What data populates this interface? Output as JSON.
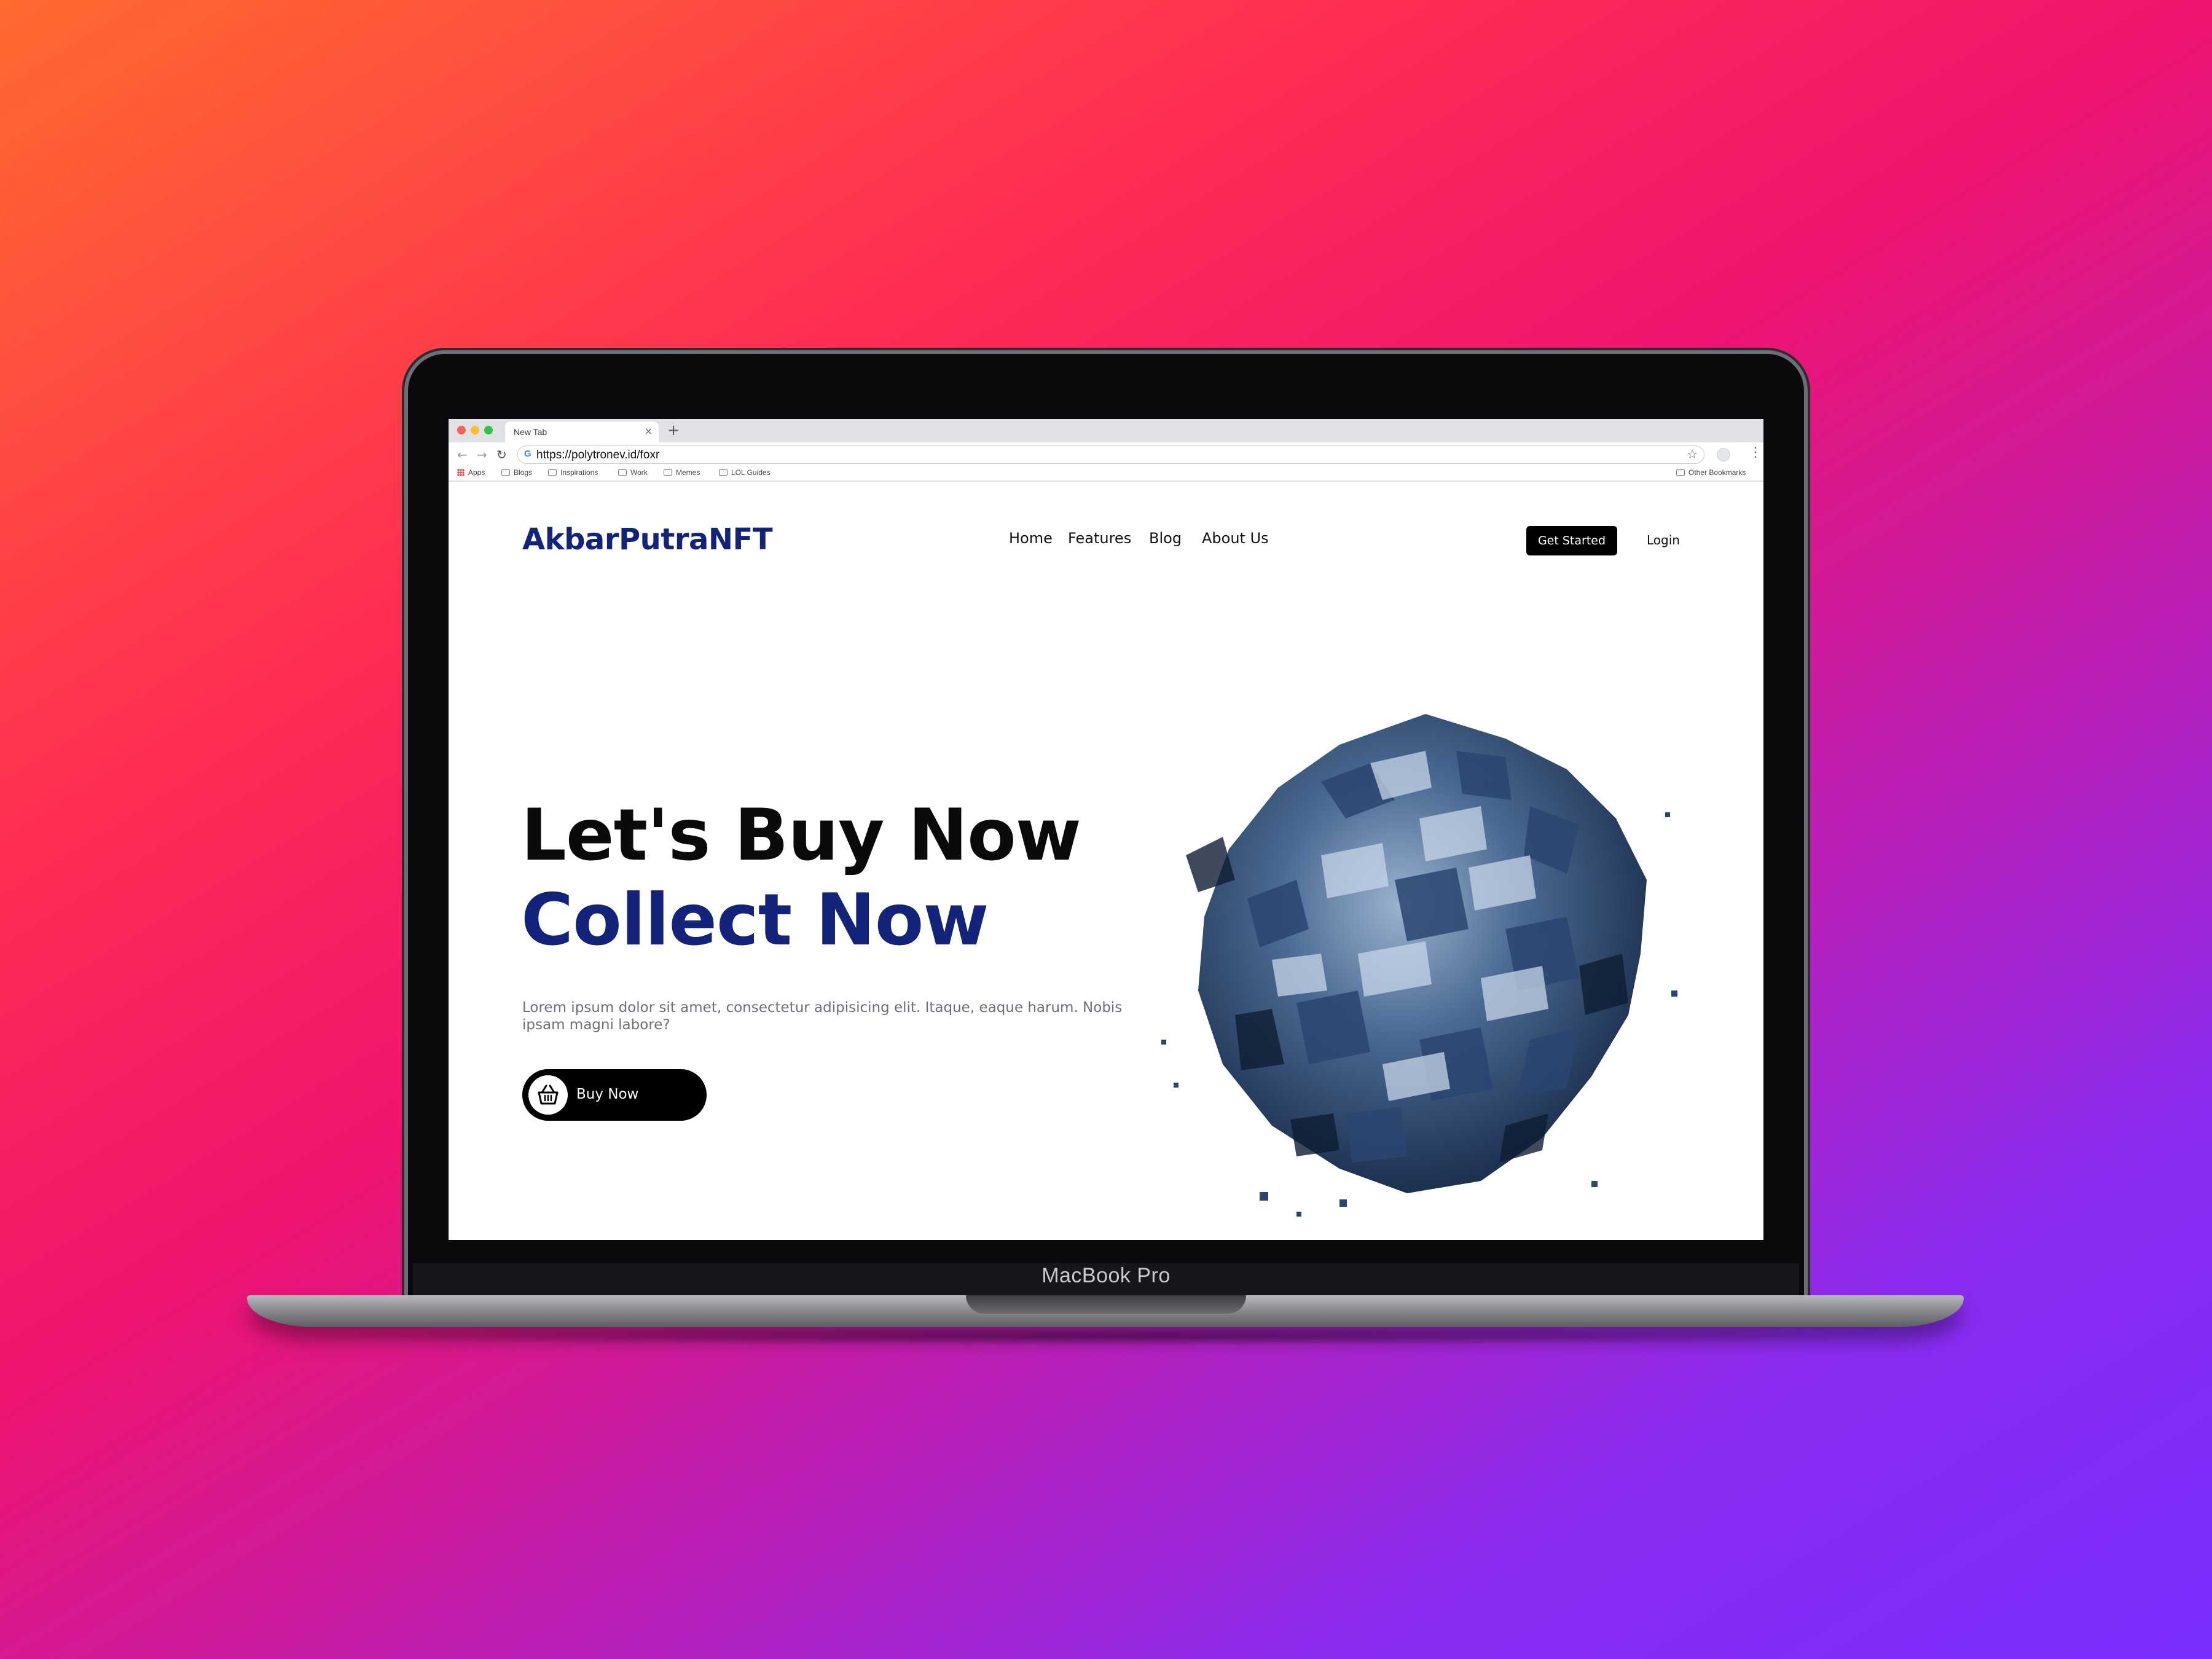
{
  "device": {
    "label": "MacBook Pro"
  },
  "browser": {
    "tab_title": "New Tab",
    "tab_close": "×",
    "new_tab": "+",
    "url": "https://polytronev.id/foxr",
    "bookmarks": [
      {
        "label": "Apps",
        "icon": "apps-grid-icon"
      },
      {
        "label": "Blogs",
        "icon": "folder-icon"
      },
      {
        "label": "Inspirations",
        "icon": "folder-icon"
      },
      {
        "label": "Work",
        "icon": "folder-icon"
      },
      {
        "label": "Memes",
        "icon": "folder-icon"
      },
      {
        "label": "LOL Guides",
        "icon": "folder-icon"
      }
    ],
    "other_bookmarks": "Other Bookmarks"
  },
  "site": {
    "logo": "AkbarPutraNFT",
    "nav": [
      "Home",
      "Features",
      "Blog",
      "About Us"
    ],
    "get_started": "Get Started",
    "login": "Login",
    "headline_line1": "Let's Buy Now",
    "headline_line2": "Collect Now",
    "description": "Lorem ipsum dolor sit amet, consectetur adipisicing elit. Itaque, eaque harum. Nobis ipsam magni labore?",
    "buy_button": "Buy Now",
    "hero_image": "nft-cube-sphere-illustration"
  },
  "colors": {
    "brand_navy": "#13237a",
    "button_black": "#000000",
    "background_gradient": [
      "#ff6a2e",
      "#ff2a55",
      "#ee1470",
      "#b91fb8",
      "#7a2dff"
    ]
  }
}
